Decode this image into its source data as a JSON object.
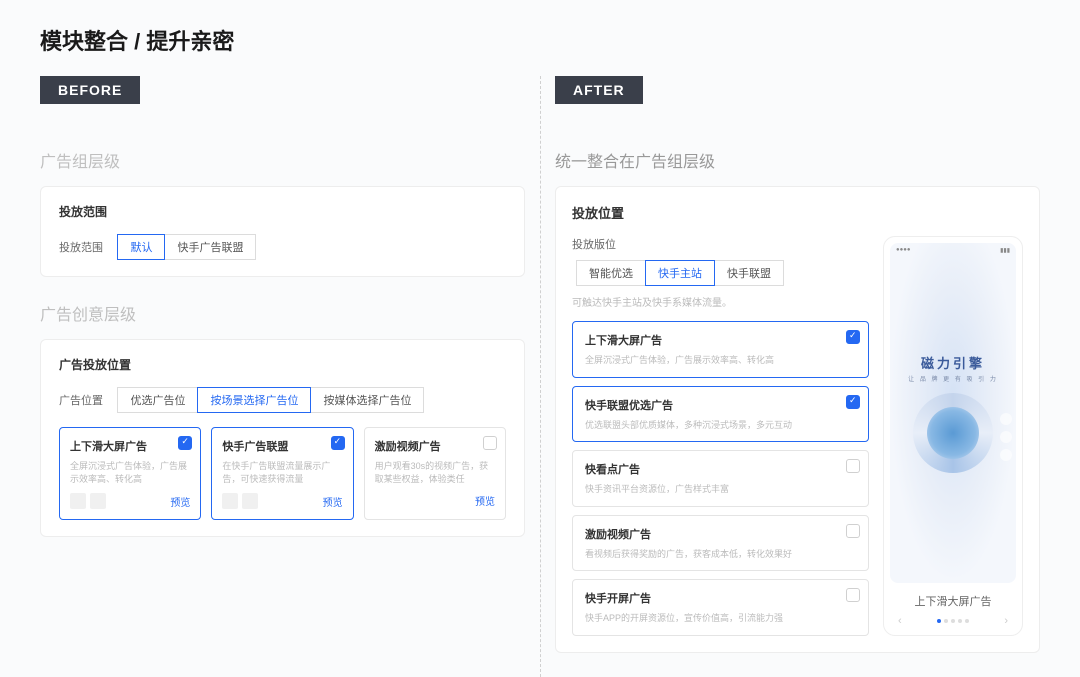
{
  "title": "模块整合 / 提升亲密",
  "before": {
    "badge": "BEFORE",
    "section1": {
      "label": "广告组层级",
      "card_title": "投放范围",
      "row_label": "投放范围",
      "options": [
        "默认",
        "快手广告联盟"
      ],
      "active": 0
    },
    "section2": {
      "label": "广告创意层级",
      "card_title": "广告投放位置",
      "row_label": "广告位置",
      "tabs": [
        "优选广告位",
        "按场景选择广告位",
        "按媒体选择广告位"
      ],
      "active_tab": 1,
      "cards": [
        {
          "title": "上下滑大屏广告",
          "desc": "全屏沉浸式广告体验，广告展示效率高、转化高",
          "checked": true,
          "preview": "预览",
          "thumbs": true
        },
        {
          "title": "快手广告联盟",
          "desc": "在快手广告联盟流量展示广告，可快速获得流量",
          "checked": true,
          "preview": "预览",
          "thumbs": true
        },
        {
          "title": "激励视频广告",
          "desc": "用户观看30s的视频广告，获取某些权益，体验类任",
          "checked": false,
          "preview": "预览",
          "thumbs": false
        }
      ]
    }
  },
  "after": {
    "badge": "AFTER",
    "section_label": "统一整合在广告组层级",
    "card_title": "投放位置",
    "sub_title": "投放版位",
    "tabs": [
      "智能优选",
      "快手主站",
      "快手联盟"
    ],
    "active_tab": 1,
    "hint": "可触达快手主站及快手系媒体流量。",
    "options": [
      {
        "title": "上下滑大屏广告",
        "desc": "全屏沉浸式广告体验，广告展示效率高、转化高",
        "checked": true
      },
      {
        "title": "快手联盟优选广告",
        "desc": "优选联盟头部优质媒体，多种沉浸式场景，多元互动",
        "checked": true
      },
      {
        "title": "快看点广告",
        "desc": "快手资讯平台资源位，广告样式丰富",
        "checked": false
      },
      {
        "title": "激励视频广告",
        "desc": "看视频后获得奖励的广告，获客成本低，转化效果好",
        "checked": false
      },
      {
        "title": "快手开屏广告",
        "desc": "快手APP的开屏资源位，宣传价值高，引流能力强",
        "checked": false
      }
    ],
    "phone": {
      "logo": "磁力引擎",
      "sub": "让 品 牌 更 有 吸 引 力",
      "caption": "上下滑大屏广告"
    }
  }
}
